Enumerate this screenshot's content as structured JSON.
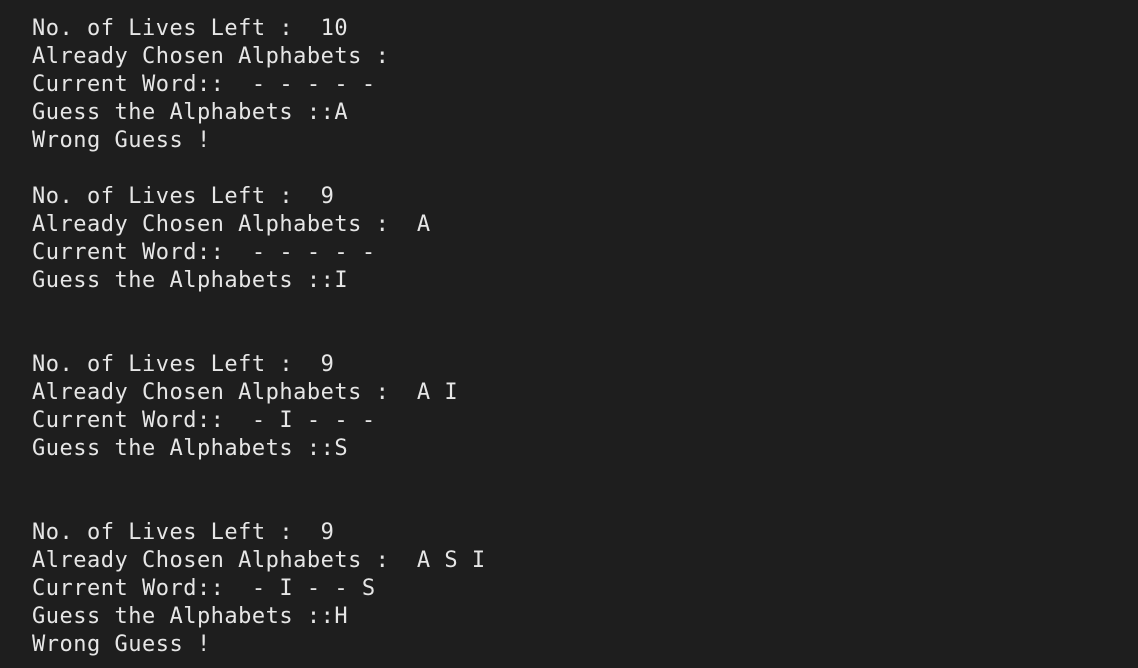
{
  "terminal": {
    "lines": [
      "No. of Lives Left :  10",
      "Already Chosen Alphabets :",
      "Current Word::  - - - - -",
      "Guess the Alphabets ::A",
      "Wrong Guess !",
      "",
      "No. of Lives Left :  9",
      "Already Chosen Alphabets :  A",
      "Current Word::  - - - - -",
      "Guess the Alphabets ::I",
      "",
      "",
      "No. of Lives Left :  9",
      "Already Chosen Alphabets :  A I",
      "Current Word::  - I - - -",
      "Guess the Alphabets ::S",
      "",
      "",
      "No. of Lives Left :  9",
      "Already Chosen Alphabets :  A S I",
      "Current Word::  - I - - S",
      "Guess the Alphabets ::H",
      "Wrong Guess !"
    ]
  }
}
